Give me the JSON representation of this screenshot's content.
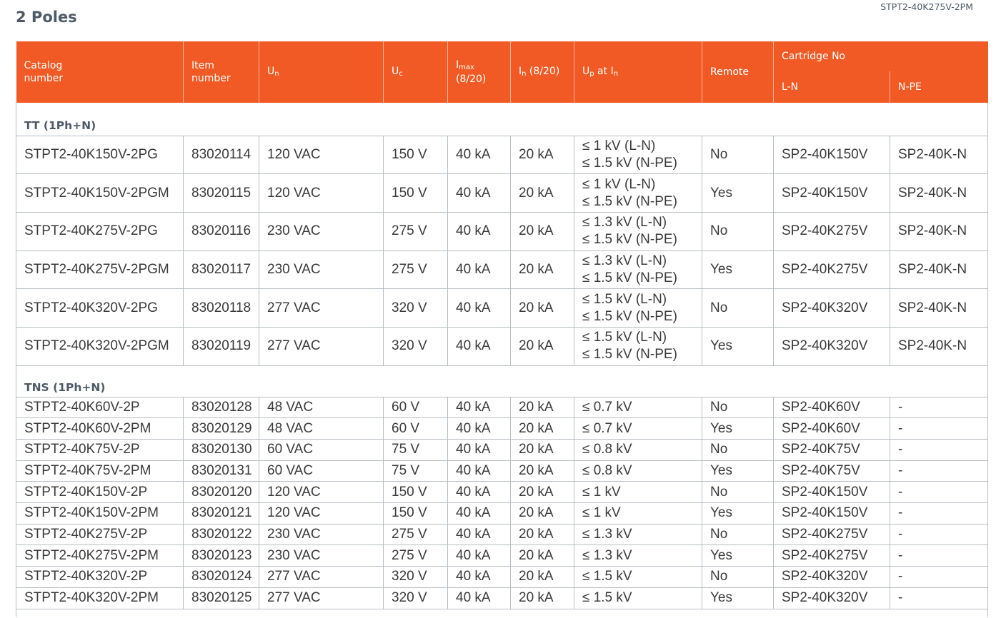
{
  "page": {
    "title": "2 Poles",
    "reference": "STPT2-40K275V-2PM"
  },
  "table": {
    "headers": {
      "catalog": [
        "Catalog",
        "number"
      ],
      "item": [
        "Item",
        "number"
      ],
      "un": {
        "main": "U",
        "sub": "n"
      },
      "uc": {
        "main": "U",
        "sub": "c"
      },
      "imax": {
        "main": "I",
        "sub": "max",
        "line2": "(8/20)"
      },
      "in": {
        "main": "I",
        "sub": "n",
        "rest": " (8/20)"
      },
      "up": {
        "main": "U",
        "sub": "p",
        "mid": " at I",
        "sub2": "n"
      },
      "remote": "Remote",
      "cartridge": "Cartridge No",
      "ln": "L-N",
      "npe": "N-PE"
    },
    "sections": [
      {
        "title": "TT (1Ph+N)",
        "rows": [
          {
            "catalog": "STPT2-40K150V-2PG",
            "item": "83020114",
            "un": "120 VAC",
            "uc": "150 V",
            "imax": "40 kA",
            "in": "20 kA",
            "up": [
              "≤ 1 kV (L-N)",
              "≤ 1.5 kV (N-PE)"
            ],
            "remote": "No",
            "ln": "SP2-40K150V",
            "npe": "SP2-40K-N"
          },
          {
            "catalog": "STPT2-40K150V-2PGM",
            "item": "83020115",
            "un": "120 VAC",
            "uc": "150 V",
            "imax": "40 kA",
            "in": "20 kA",
            "up": [
              "≤ 1 kV (L-N)",
              "≤ 1.5 kV (N-PE)"
            ],
            "remote": "Yes",
            "ln": "SP2-40K150V",
            "npe": "SP2-40K-N"
          },
          {
            "catalog": "STPT2-40K275V-2PG",
            "item": "83020116",
            "un": "230 VAC",
            "uc": "275 V",
            "imax": "40 kA",
            "in": "20 kA",
            "up": [
              "≤ 1.3 kV (L-N)",
              "≤ 1.5 kV (N-PE)"
            ],
            "remote": "No",
            "ln": "SP2-40K275V",
            "npe": "SP2-40K-N"
          },
          {
            "catalog": "STPT2-40K275V-2PGM",
            "item": "83020117",
            "un": "230 VAC",
            "uc": "275 V",
            "imax": "40 kA",
            "in": "20 kA",
            "up": [
              "≤ 1.3 kV (L-N)",
              "≤ 1.5 kV (N-PE)"
            ],
            "remote": "Yes",
            "ln": "SP2-40K275V",
            "npe": "SP2-40K-N"
          },
          {
            "catalog": "STPT2-40K320V-2PG",
            "item": "83020118",
            "un": "277 VAC",
            "uc": "320 V",
            "imax": "40 kA",
            "in": "20 kA",
            "up": [
              "≤ 1.5 kV (L-N)",
              "≤ 1.5 kV (N-PE)"
            ],
            "remote": "No",
            "ln": "SP2-40K320V",
            "npe": "SP2-40K-N"
          },
          {
            "catalog": "STPT2-40K320V-2PGM",
            "item": "83020119",
            "un": "277 VAC",
            "uc": "320 V",
            "imax": "40 kA",
            "in": "20 kA",
            "up": [
              "≤ 1.5 kV (L-N)",
              "≤ 1.5 kV (N-PE)"
            ],
            "remote": "Yes",
            "ln": "SP2-40K320V",
            "npe": "SP2-40K-N"
          }
        ]
      },
      {
        "title": "TNS (1Ph+N)",
        "rows": [
          {
            "catalog": "STPT2-40K60V-2P",
            "item": "83020128",
            "un": "48 VAC",
            "uc": "60 V",
            "imax": "40 kA",
            "in": "20 kA",
            "up": [
              "≤ 0.7 kV"
            ],
            "remote": "No",
            "ln": "SP2-40K60V",
            "npe": "-"
          },
          {
            "catalog": "STPT2-40K60V-2PM",
            "item": "83020129",
            "un": "48 VAC",
            "uc": "60 V",
            "imax": "40 kA",
            "in": "20 kA",
            "up": [
              "≤ 0.7 kV"
            ],
            "remote": "Yes",
            "ln": "SP2-40K60V",
            "npe": "-"
          },
          {
            "catalog": "STPT2-40K75V-2P",
            "item": "83020130",
            "un": "60 VAC",
            "uc": "75 V",
            "imax": "40 kA",
            "in": "20 kA",
            "up": [
              "≤ 0.8 kV"
            ],
            "remote": "No",
            "ln": "SP2-40K75V",
            "npe": "-"
          },
          {
            "catalog": "STPT2-40K75V-2PM",
            "item": "83020131",
            "un": "60 VAC",
            "uc": "75 V",
            "imax": "40 kA",
            "in": "20 kA",
            "up": [
              "≤ 0.8 kV"
            ],
            "remote": "Yes",
            "ln": "SP2-40K75V",
            "npe": "-"
          },
          {
            "catalog": "STPT2-40K150V-2P",
            "item": "83020120",
            "un": "120 VAC",
            "uc": "150 V",
            "imax": "40 kA",
            "in": "20 kA",
            "up": [
              "≤ 1 kV"
            ],
            "remote": "No",
            "ln": "SP2-40K150V",
            "npe": "-"
          },
          {
            "catalog": "STPT2-40K150V-2PM",
            "item": "83020121",
            "un": "120 VAC",
            "uc": "150 V",
            "imax": "40 kA",
            "in": "20 kA",
            "up": [
              "≤ 1 kV"
            ],
            "remote": "Yes",
            "ln": "SP2-40K150V",
            "npe": "-"
          },
          {
            "catalog": "STPT2-40K275V-2P",
            "item": "83020122",
            "un": "230 VAC",
            "uc": "275 V",
            "imax": "40 kA",
            "in": "20 kA",
            "up": [
              "≤ 1.3 kV"
            ],
            "remote": "No",
            "ln": "SP2-40K275V",
            "npe": "-"
          },
          {
            "catalog": "STPT2-40K275V-2PM",
            "item": "83020123",
            "un": "230 VAC",
            "uc": "275 V",
            "imax": "40 kA",
            "in": "20 kA",
            "up": [
              "≤ 1.3 kV"
            ],
            "remote": "Yes",
            "ln": "SP2-40K275V",
            "npe": "-"
          },
          {
            "catalog": "STPT2-40K320V-2P",
            "item": "83020124",
            "un": "277 VAC",
            "uc": "320 V",
            "imax": "40 kA",
            "in": "20 kA",
            "up": [
              "≤ 1.5 kV"
            ],
            "remote": "No",
            "ln": "SP2-40K320V",
            "npe": "-"
          },
          {
            "catalog": "STPT2-40K320V-2PM",
            "item": "83020125",
            "un": "277 VAC",
            "uc": "320 V",
            "imax": "40 kA",
            "in": "20 kA",
            "up": [
              "≤ 1.5 kV"
            ],
            "remote": "Yes",
            "ln": "SP2-40K320V",
            "npe": "-"
          }
        ]
      }
    ]
  },
  "colors": {
    "header_bg": "#f15a24",
    "header_text": "#ffffff",
    "title_text": "#4d5a66",
    "grid": "#b8bec4"
  }
}
